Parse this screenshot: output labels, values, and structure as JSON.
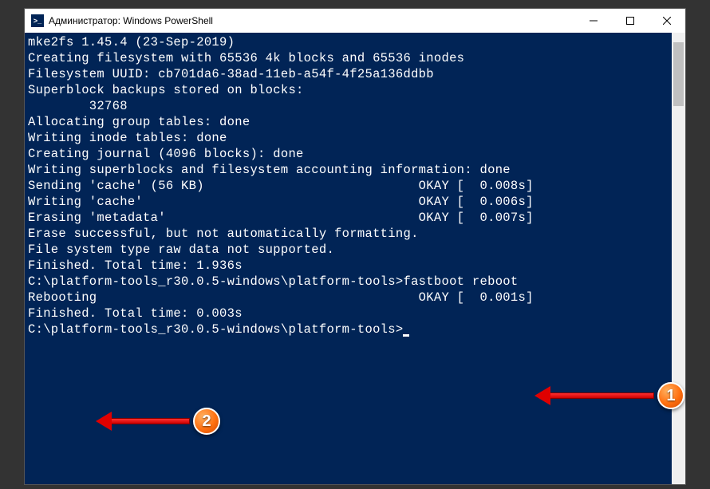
{
  "window": {
    "title": "Администратор: Windows PowerShell"
  },
  "terminal": {
    "lines": [
      "mke2fs 1.45.4 (23-Sep-2019)",
      "Creating filesystem with 65536 4k blocks and 65536 inodes",
      "Filesystem UUID: cb701da6-38ad-11eb-a54f-4f25a136ddbb",
      "Superblock backups stored on blocks:",
      "        32768",
      "",
      "Allocating group tables: done",
      "Writing inode tables: done",
      "Creating journal (4096 blocks): done",
      "Writing superblocks and filesystem accounting information: done",
      "",
      "Sending 'cache' (56 KB)                            OKAY [  0.008s]",
      "Writing 'cache'                                    OKAY [  0.006s]",
      "Erasing 'metadata'                                 OKAY [  0.007s]",
      "Erase successful, but not automatically formatting.",
      "File system type raw data not supported.",
      "Finished. Total time: 1.936s",
      "",
      "C:\\platform-tools_r30.0.5-windows\\platform-tools>fastboot reboot",
      "Rebooting                                          OKAY [  0.001s]",
      "Finished. Total time: 0.003s",
      "",
      "C:\\platform-tools_r30.0.5-windows\\platform-tools>"
    ]
  },
  "annotations": {
    "badge1": "1",
    "badge2": "2"
  }
}
